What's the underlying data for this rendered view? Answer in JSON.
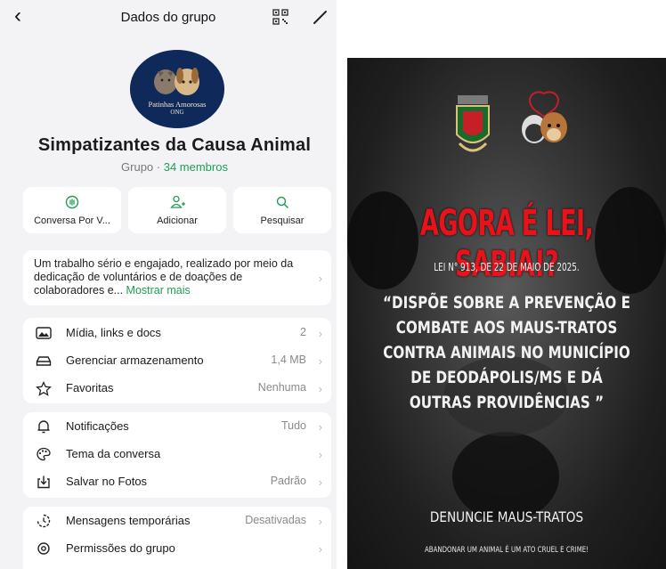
{
  "header": {
    "title": "Dados do grupo",
    "back_icon": "chevron-left-icon",
    "qr_icon": "qr-code-icon",
    "edit_icon": "pencil-icon"
  },
  "group": {
    "logo_text": "Patinhas Amorosas",
    "logo_sub": "ONG",
    "name": "Simpatizantes da Causa Animal",
    "type_label": "Grupo · ",
    "members": "34 membros"
  },
  "actions": [
    {
      "label": "Conversa Por V...",
      "icon": "voice-chat-icon"
    },
    {
      "label": "Adicionar",
      "icon": "add-person-icon"
    },
    {
      "label": "Pesquisar",
      "icon": "search-icon"
    }
  ],
  "description": {
    "text": "Um trabalho sério e engajado, realizado por meio da dedicação de voluntários e de doações de colaboradores e...",
    "more": "Mostrar mais"
  },
  "sections": {
    "media": [
      {
        "label": "Mídia, links e docs",
        "value": "2",
        "icon": "image-icon"
      },
      {
        "label": "Gerenciar armazenamento",
        "value": "1,4 MB",
        "icon": "storage-icon"
      },
      {
        "label": "Favoritas",
        "value": "Nenhuma",
        "icon": "star-icon"
      }
    ],
    "settings": [
      {
        "label": "Notificações",
        "value": "Tudo",
        "icon": "bell-icon"
      },
      {
        "label": "Tema da conversa",
        "value": "",
        "icon": "palette-icon"
      },
      {
        "label": "Salvar no Fotos",
        "value": "Padrão",
        "icon": "download-icon"
      }
    ],
    "group": [
      {
        "label": "Mensagens temporárias",
        "value": "Desativadas",
        "icon": "timer-icon"
      },
      {
        "label": "Permissões do grupo",
        "value": "",
        "icon": "gear-icon"
      }
    ]
  },
  "poster": {
    "headline": "AGORA É LEI, SABIA!?",
    "lei": "LEI N° 913, DE 22 DE MAIO DE 2025.",
    "quote": "“DISPÕE SOBRE A PREVENÇÃO E COMBATE AOS MAUS-TRATOS CONTRA ANIMAIS NO MUNICÍPIO DE DEODÁPOLIS/MS E DÁ OUTRAS PROVIDÊNCIAS ”",
    "denuncie": "DENUNCIE MAUS-TRATOS",
    "abandonar": "ABANDONAR UM ANIMAL É UM ATO CRUEL E CRIME!",
    "colors": {
      "headline": "#e8121b",
      "background": "#2a2a2a"
    }
  },
  "colors": {
    "accent": "#1f9d55",
    "page_bg": "#f3f3f5"
  }
}
